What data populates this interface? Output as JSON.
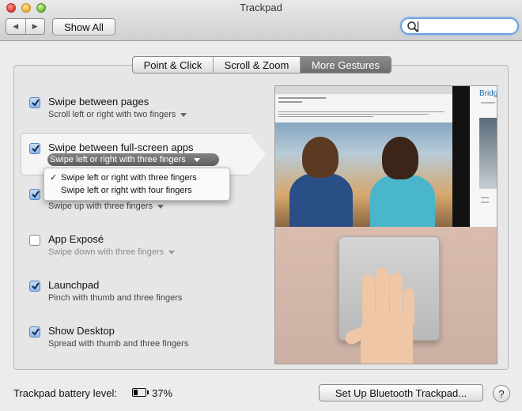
{
  "window": {
    "title": "Trackpad"
  },
  "toolbar": {
    "back_icon": "chevron-left-icon",
    "forward_icon": "chevron-right-icon",
    "show_all_label": "Show All",
    "search": {
      "value": "",
      "placeholder": "",
      "icon": "search-icon"
    }
  },
  "tabs": [
    {
      "label": "Point & Click",
      "active": false
    },
    {
      "label": "Scroll & Zoom",
      "active": false
    },
    {
      "label": "More Gestures",
      "active": true
    }
  ],
  "gestures": [
    {
      "title": "Swipe between pages",
      "detail": "Scroll left or right with two fingers",
      "checked": true,
      "has_menu": true
    },
    {
      "title": "Swipe between full-screen apps",
      "detail": "Swipe left or right with three fingers",
      "checked": true,
      "has_menu": true,
      "selected": true
    },
    {
      "title": "",
      "detail": "Swipe up with three fingers",
      "checked": true,
      "has_menu": true
    },
    {
      "title": "App Exposé",
      "detail": "Swipe down with three fingers",
      "checked": false,
      "has_menu": true
    },
    {
      "title": "Launchpad",
      "detail": "Pinch with thumb and three fingers",
      "checked": true,
      "has_menu": false
    },
    {
      "title": "Show Desktop",
      "detail": "Spread with thumb and three fingers",
      "checked": true,
      "has_menu": false
    }
  ],
  "dropdown_menu": {
    "items": [
      {
        "label": "Swipe left or right with three fingers",
        "checked": true
      },
      {
        "label": "Swipe left or right with four fingers",
        "checked": false
      }
    ]
  },
  "preview": {
    "side_page_text": "Bridg"
  },
  "footer": {
    "battery_label": "Trackpad battery level:",
    "battery_percent": "37%",
    "battery_level": 0.37,
    "setup_button": "Set Up Bluetooth Trackpad...",
    "help_label": "?"
  }
}
